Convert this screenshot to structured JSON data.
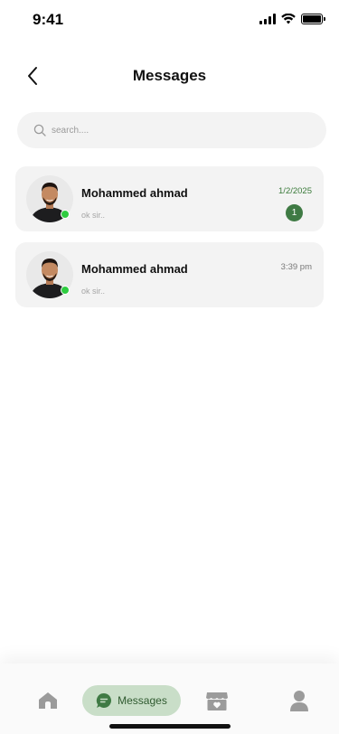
{
  "status_bar": {
    "time": "9:41"
  },
  "header": {
    "title": "Messages"
  },
  "search": {
    "placeholder": "search...."
  },
  "conversations": [
    {
      "name": "Mohammed ahmad",
      "preview": "ok sir..",
      "time": "1/2/2025",
      "unread": "1",
      "online": true
    },
    {
      "name": "Mohammed ahmad",
      "preview": "ok sir..",
      "time": "3:39 pm",
      "online": true
    }
  ],
  "bottom_nav": {
    "items": [
      {
        "icon": "home-icon"
      },
      {
        "icon": "chat-icon",
        "label": "Messages",
        "active": true
      },
      {
        "icon": "shop-icon"
      },
      {
        "icon": "profile-icon"
      }
    ]
  },
  "colors": {
    "accent": "#3f7a44",
    "accent_light": "#c9dec8",
    "online": "#2ecc40",
    "card_bg": "#f3f3f3"
  }
}
